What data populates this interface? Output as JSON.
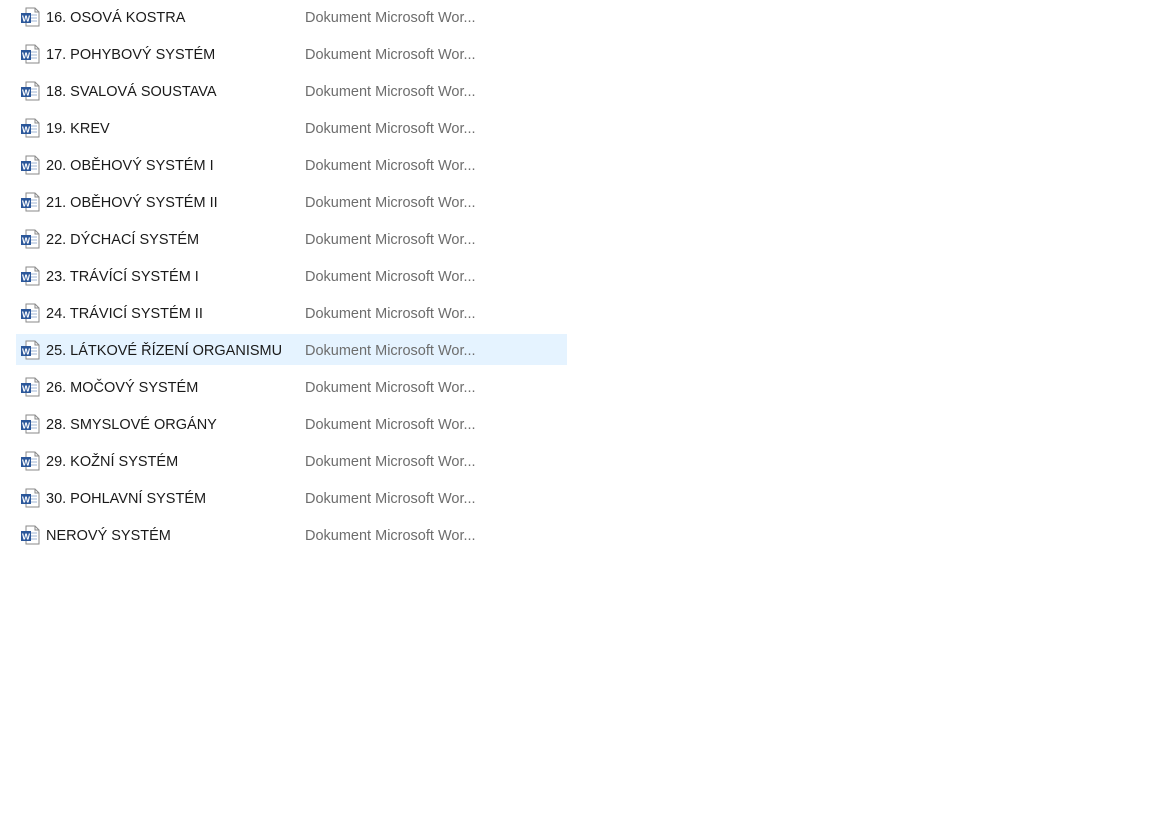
{
  "file_list": {
    "selected_index": 9,
    "icon": "word-document-icon",
    "accent_color": "#2b579a",
    "selected_row_color": "#e5f3ff",
    "items": [
      {
        "name": "16. OSOVÁ KOSTRA",
        "type": "Dokument Microsoft Wor..."
      },
      {
        "name": "17. POHYBOVÝ SYSTÉM",
        "type": "Dokument Microsoft Wor..."
      },
      {
        "name": "18. SVALOVÁ SOUSTAVA",
        "type": "Dokument Microsoft Wor..."
      },
      {
        "name": "19. KREV",
        "type": "Dokument Microsoft Wor..."
      },
      {
        "name": "20. OBĚHOVÝ SYSTÉM I",
        "type": "Dokument Microsoft Wor..."
      },
      {
        "name": "21. OBĚHOVÝ SYSTÉM II",
        "type": "Dokument Microsoft Wor..."
      },
      {
        "name": "22. DÝCHACÍ SYSTÉM",
        "type": "Dokument Microsoft Wor..."
      },
      {
        "name": "23. TRÁVÍCÍ SYSTÉM I",
        "type": "Dokument Microsoft Wor..."
      },
      {
        "name": "24. TRÁVICÍ SYSTÉM II",
        "type": "Dokument Microsoft Wor..."
      },
      {
        "name": "25. LÁTKOVÉ ŘÍZENÍ ORGANISMU",
        "type": "Dokument Microsoft Wor..."
      },
      {
        "name": "26. MOČOVÝ SYSTÉM",
        "type": "Dokument Microsoft Wor..."
      },
      {
        "name": "28. SMYSLOVÉ ORGÁNY",
        "type": "Dokument Microsoft Wor..."
      },
      {
        "name": "29. KOŽNÍ SYSTÉM",
        "type": "Dokument Microsoft Wor..."
      },
      {
        "name": "30. POHLAVNÍ SYSTÉM",
        "type": "Dokument Microsoft Wor..."
      },
      {
        "name": "NEROVÝ SYSTÉM",
        "type": "Dokument Microsoft Wor..."
      }
    ]
  }
}
